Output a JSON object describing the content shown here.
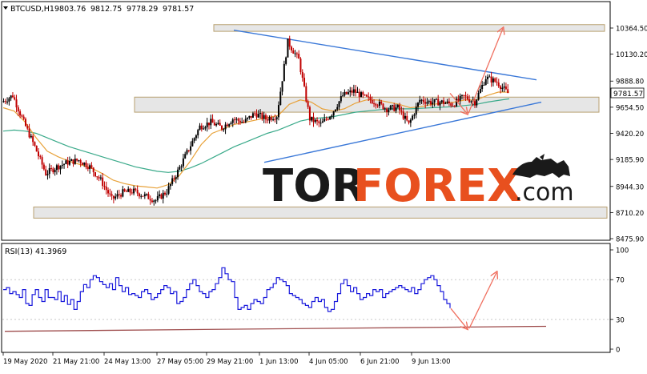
{
  "main_chart": {
    "header": {
      "symbol": "BTCUSD,H1",
      "open": "9803.76",
      "high": "9812.75",
      "low": "9778.29",
      "close": "9781.57"
    },
    "current_price_label": "9781.57",
    "price_axis_labels": [
      "10364.50",
      "10130.20",
      "9888.80",
      "9654.50",
      "9420.20",
      "9185.90",
      "8944.30",
      "8710.20",
      "8475.90"
    ],
    "time_axis_labels": [
      "19 May 2020",
      "21 May 21:00",
      "24 May 13:00",
      "27 May 05:00",
      "29 May 21:00",
      "1 Jun 13:00",
      "4 Jun 05:00",
      "6 Jun 21:00",
      "9 Jun 13:00"
    ]
  },
  "rsi_panel": {
    "title": "RSI(13) 41.3969",
    "axis_labels": [
      "100",
      "70",
      "30",
      "0"
    ]
  },
  "watermark": {
    "part1": "TOR",
    "part2": "FOREX",
    "part3": ".com"
  },
  "colors": {
    "bull_candle": "#000000",
    "bear_candle": "#c00000",
    "ma_fast": "#e8a23a",
    "ma_slow": "#3aaa8a",
    "trendline": "#3a78d8",
    "forecast_arrow": "#f07060",
    "rsi_line": "#1a1adc",
    "rsi_support": "#a05050",
    "zone_fill": "#e6e6e6",
    "watermark_dark": "#1a1a1a",
    "watermark_orange": "#e8501e"
  },
  "chart_data": [
    {
      "type": "candlestick",
      "title": "BTCUSD,H1",
      "ylim": [
        8475.9,
        10364.5
      ],
      "x_ticks": [
        "19 May 2020",
        "21 May 21:00",
        "24 May 13:00",
        "27 May 05:00",
        "29 May 21:00",
        "1 Jun 13:00",
        "4 Jun 05:00",
        "6 Jun 21:00",
        "9 Jun 13:00"
      ],
      "close_path": [
        {
          "x": "19 May 2020",
          "close": 9700
        },
        {
          "x": "20 May",
          "close": 9760
        },
        {
          "x": "20 May 12:00",
          "close": 9520
        },
        {
          "x": "21 May",
          "close": 9300
        },
        {
          "x": "21 May 21:00",
          "close": 9060
        },
        {
          "x": "22 May",
          "close": 9120
        },
        {
          "x": "22 May 12:00",
          "close": 9160
        },
        {
          "x": "23 May",
          "close": 9180
        },
        {
          "x": "23 May 12:00",
          "close": 9120
        },
        {
          "x": "24 May",
          "close": 9000
        },
        {
          "x": "24 May 13:00",
          "close": 8830
        },
        {
          "x": "25 May",
          "close": 8890
        },
        {
          "x": "25 May 12:00",
          "close": 8900
        },
        {
          "x": "26 May",
          "close": 8860
        },
        {
          "x": "26 May 12:00",
          "close": 8820
        },
        {
          "x": "27 May",
          "close": 8900
        },
        {
          "x": "27 May 05:00",
          "close": 9080
        },
        {
          "x": "27 May 12:00",
          "close": 9280
        },
        {
          "x": "28 May",
          "close": 9480
        },
        {
          "x": "28 May 12:00",
          "close": 9520
        },
        {
          "x": "29 May",
          "close": 9470
        },
        {
          "x": "29 May 21:00",
          "close": 9550
        },
        {
          "x": "30 May",
          "close": 9520
        },
        {
          "x": "31 May",
          "close": 9600
        },
        {
          "x": "31 May 12:00",
          "close": 9550
        },
        {
          "x": "1 Jun",
          "close": 9580
        },
        {
          "x": "1 Jun 13:00",
          "close": 10240
        },
        {
          "x": "2 Jun",
          "close": 10080
        },
        {
          "x": "2 Jun 12:00",
          "close": 9550
        },
        {
          "x": "3 Jun",
          "close": 9500
        },
        {
          "x": "3 Jun 12:00",
          "close": 9600
        },
        {
          "x": "4 Jun 05:00",
          "close": 9760
        },
        {
          "x": "4 Jun 12:00",
          "close": 9800
        },
        {
          "x": "5 Jun",
          "close": 9740
        },
        {
          "x": "5 Jun 12:00",
          "close": 9700
        },
        {
          "x": "6 Jun",
          "close": 9640
        },
        {
          "x": "6 Jun 21:00",
          "close": 9650
        },
        {
          "x": "7 Jun",
          "close": 9500
        },
        {
          "x": "7 Jun 12:00",
          "close": 9720
        },
        {
          "x": "8 Jun",
          "close": 9700
        },
        {
          "x": "8 Jun 12:00",
          "close": 9700
        },
        {
          "x": "9 Jun",
          "close": 9680
        },
        {
          "x": "9 Jun 13:00",
          "close": 9750
        },
        {
          "x": "10 Jun",
          "close": 9700
        },
        {
          "x": "10 Jun 06:00",
          "close": 9920
        },
        {
          "x": "10 Jun 12:00",
          "close": 9880
        },
        {
          "x": "10 Jun 18:00",
          "close": 9781.57
        }
      ],
      "ma_fast_path": [
        9650,
        9620,
        9520,
        9380,
        9260,
        9210,
        9170,
        9140,
        9110,
        9060,
        9000,
        8970,
        8950,
        8940,
        8930,
        8960,
        9040,
        9170,
        9320,
        9420,
        9460,
        9500,
        9520,
        9540,
        9560,
        9580,
        9680,
        9720,
        9700,
        9640,
        9620,
        9640,
        9690,
        9720,
        9720,
        9700,
        9680,
        9650,
        9660,
        9680,
        9690,
        9700,
        9720,
        9720,
        9760,
        9790,
        9790
      ],
      "ma_slow_path": [
        9440,
        9450,
        9440,
        9420,
        9380,
        9340,
        9300,
        9270,
        9240,
        9210,
        9180,
        9150,
        9120,
        9100,
        9080,
        9070,
        9080,
        9110,
        9150,
        9200,
        9250,
        9300,
        9340,
        9380,
        9420,
        9450,
        9490,
        9530,
        9550,
        9560,
        9570,
        9590,
        9610,
        9620,
        9630,
        9640,
        9640,
        9640,
        9645,
        9650,
        9655,
        9660,
        9670,
        9680,
        9700,
        9715,
        9730
      ],
      "resistance_zone": [
        10335,
        10395
      ],
      "middle_zone": [
        9610,
        9745
      ],
      "support_zone": [
        8660,
        8760
      ],
      "descending_trendline": [
        {
          "x": "29 May 21:00",
          "y": 10345
        },
        {
          "x": "after 10 Jun",
          "y": 9900
        }
      ],
      "ascending_trendline": [
        {
          "x": "1 Jun 13:00",
          "y": 9160
        },
        {
          "x": "after 10 Jun",
          "y": 9700
        }
      ],
      "forecast_arrows": [
        {
          "from": 9780,
          "to": 9600
        },
        {
          "from": 9600,
          "to": 10360
        }
      ]
    },
    {
      "type": "line",
      "title": "RSI(13) 41.3969",
      "ylim": [
        0,
        100
      ],
      "y_ticks": [
        100,
        70,
        30,
        0
      ],
      "series": [
        {
          "name": "RSI(13)",
          "values": [
            60,
            62,
            56,
            58,
            55,
            52,
            60,
            46,
            44,
            55,
            60,
            52,
            48,
            60,
            52,
            52,
            50,
            58,
            48,
            54,
            45,
            50,
            40,
            48,
            58,
            65,
            62,
            70,
            74,
            72,
            68,
            65,
            62,
            66,
            60,
            72,
            64,
            58,
            62,
            55,
            56,
            54,
            52,
            58,
            60,
            56,
            50,
            52,
            56,
            60,
            64,
            62,
            56,
            58,
            46,
            48,
            52,
            60,
            66,
            70,
            64,
            58,
            56,
            52,
            58,
            60,
            66,
            72,
            82,
            76,
            70,
            68,
            52,
            40,
            42,
            44,
            40,
            46,
            50,
            48,
            46,
            52,
            60,
            62,
            66,
            72,
            70,
            68,
            64,
            56,
            54,
            52,
            50,
            46,
            44,
            42,
            48,
            52,
            48,
            50,
            42,
            38,
            40,
            48,
            56,
            66,
            70,
            64,
            58,
            62,
            56,
            50,
            52,
            56,
            54,
            60,
            58,
            60,
            52,
            56,
            58,
            60,
            62,
            64,
            62,
            60,
            58,
            62,
            56,
            60,
            66,
            70,
            72,
            74,
            70,
            64,
            58,
            50,
            46,
            41.3969
          ]
        }
      ],
      "support_line": [
        {
          "x": "19 May 2020",
          "y": 18
        },
        {
          "x": "after 10 Jun",
          "y": 23
        }
      ],
      "forecast_arrows": [
        {
          "from": 41,
          "to": 21
        },
        {
          "from": 21,
          "to": 77
        }
      ]
    }
  ]
}
